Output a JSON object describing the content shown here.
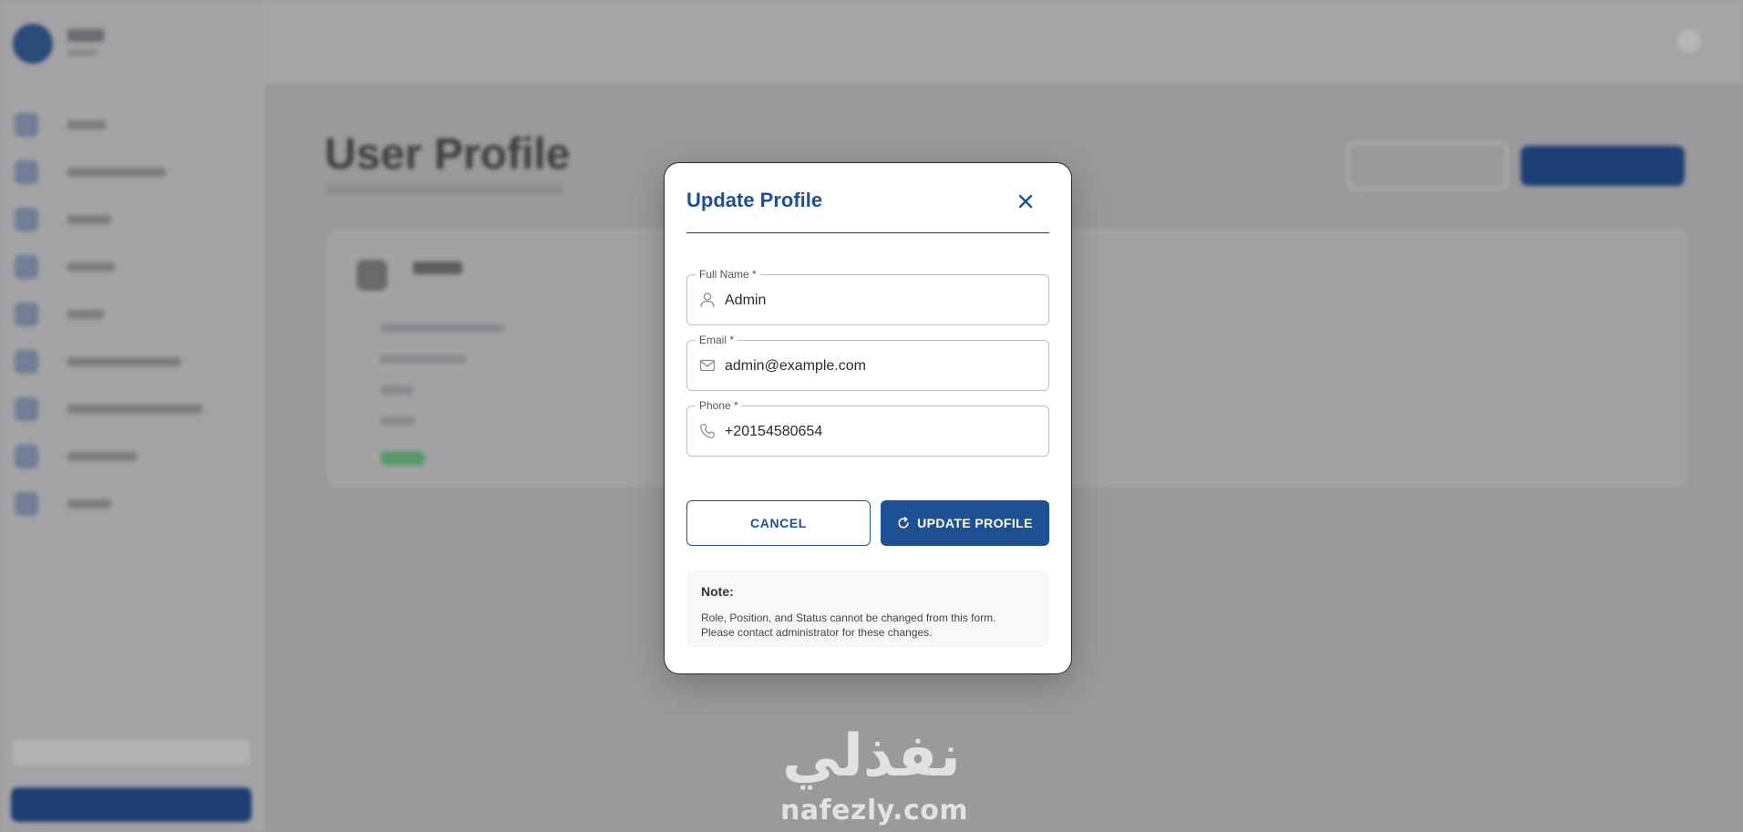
{
  "background": {
    "page_title": "User Profile"
  },
  "modal": {
    "title": "Update Profile",
    "fields": [
      {
        "label": "Full Name *",
        "value": "Admin",
        "icon": "person-icon"
      },
      {
        "label": "Email *",
        "value": "admin@example.com",
        "icon": "mail-icon"
      },
      {
        "label": "Phone *",
        "value": "+20154580654",
        "icon": "phone-icon"
      }
    ],
    "cancel_label": "CANCEL",
    "update_label": "UPDATE PROFILE",
    "note": {
      "title": "Note:",
      "line1": "Role, Position, and Status cannot be changed from this form.",
      "line2": "Please contact administrator for these changes."
    }
  },
  "watermark": {
    "arabic": "نفذلي",
    "latin": "nafezly.com"
  },
  "colors": {
    "primary": "#1e5193",
    "overlay": "#9a9a9c",
    "field_border": "#bdbdbd"
  }
}
